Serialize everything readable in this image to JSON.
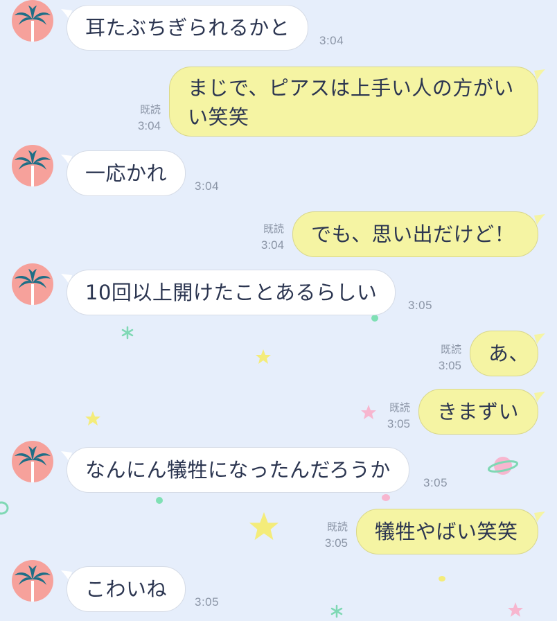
{
  "colors": {
    "background": "#e6eefb",
    "incoming_bubble": "#ffffff",
    "outgoing_bubble": "#f5f4a3",
    "avatar_bg": "#f6a19b",
    "avatar_palm": "#1f6e86",
    "timestamp": "#8b95a6"
  },
  "avatar": {
    "icon": "palm-tree-icon"
  },
  "read_label": "既読",
  "messages": [
    {
      "direction": "incoming",
      "text": "耳たぶちぎられるかと",
      "time": "3:04"
    },
    {
      "direction": "outgoing",
      "text": "まじで、ピアスは上手い人の方がいい笑笑",
      "time": "3:04",
      "read": true
    },
    {
      "direction": "incoming",
      "text": "一応かれ",
      "time": "3:04"
    },
    {
      "direction": "outgoing",
      "text": "でも、思い出だけど！",
      "time": "3:04",
      "read": true
    },
    {
      "direction": "incoming",
      "text": "10回以上開けたことあるらしい",
      "time": "3:05"
    },
    {
      "direction": "outgoing",
      "text": "あ、",
      "time": "3:05",
      "read": true
    },
    {
      "direction": "outgoing",
      "text": "きまずい",
      "time": "3:05",
      "read": true
    },
    {
      "direction": "incoming",
      "text": "なんにん犠牲になったんだろうか",
      "time": "3:05"
    },
    {
      "direction": "outgoing",
      "text": "犠牲やばい笑笑",
      "time": "3:05",
      "read": true
    },
    {
      "direction": "incoming",
      "text": "こわいね",
      "time": "3:05"
    }
  ]
}
